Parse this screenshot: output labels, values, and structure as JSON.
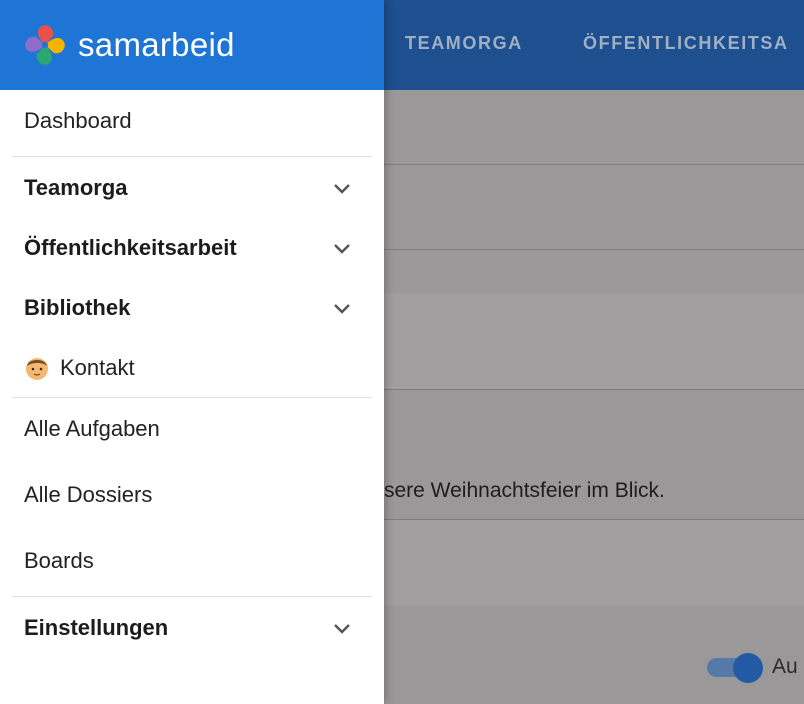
{
  "app": {
    "brand": "samarbeid",
    "logo_icon": "pinwheel-logo-icon"
  },
  "topbar": {
    "tabs": [
      {
        "label": "TEAMORGA"
      },
      {
        "label": "ÖFFENTLICHKEITSA"
      }
    ]
  },
  "background": {
    "text_snippet": "sere Weihnachtsfeier im Blick.",
    "toggle_label": "Au"
  },
  "drawer": {
    "items": [
      {
        "label": "Dashboard",
        "bold": false
      },
      {
        "label": "Teamorga",
        "bold": true,
        "expandable": true
      },
      {
        "label": "Öffentlichkeitsarbeit",
        "bold": true,
        "expandable": true
      },
      {
        "label": "Bibliothek",
        "bold": true,
        "expandable": true
      },
      {
        "label": "Kontakt",
        "bold": false,
        "icon": "user-avatar-icon"
      },
      {
        "label": "Alle Aufgaben",
        "bold": false
      },
      {
        "label": "Alle Dossiers",
        "bold": false
      },
      {
        "label": "Boards",
        "bold": false
      },
      {
        "label": "Einstellungen",
        "bold": true,
        "expandable": true
      }
    ]
  },
  "colors": {
    "header_blue": "#1f75d6",
    "topbar_blue": "#1e4f8e",
    "overlay_gray": "#9a9898"
  }
}
